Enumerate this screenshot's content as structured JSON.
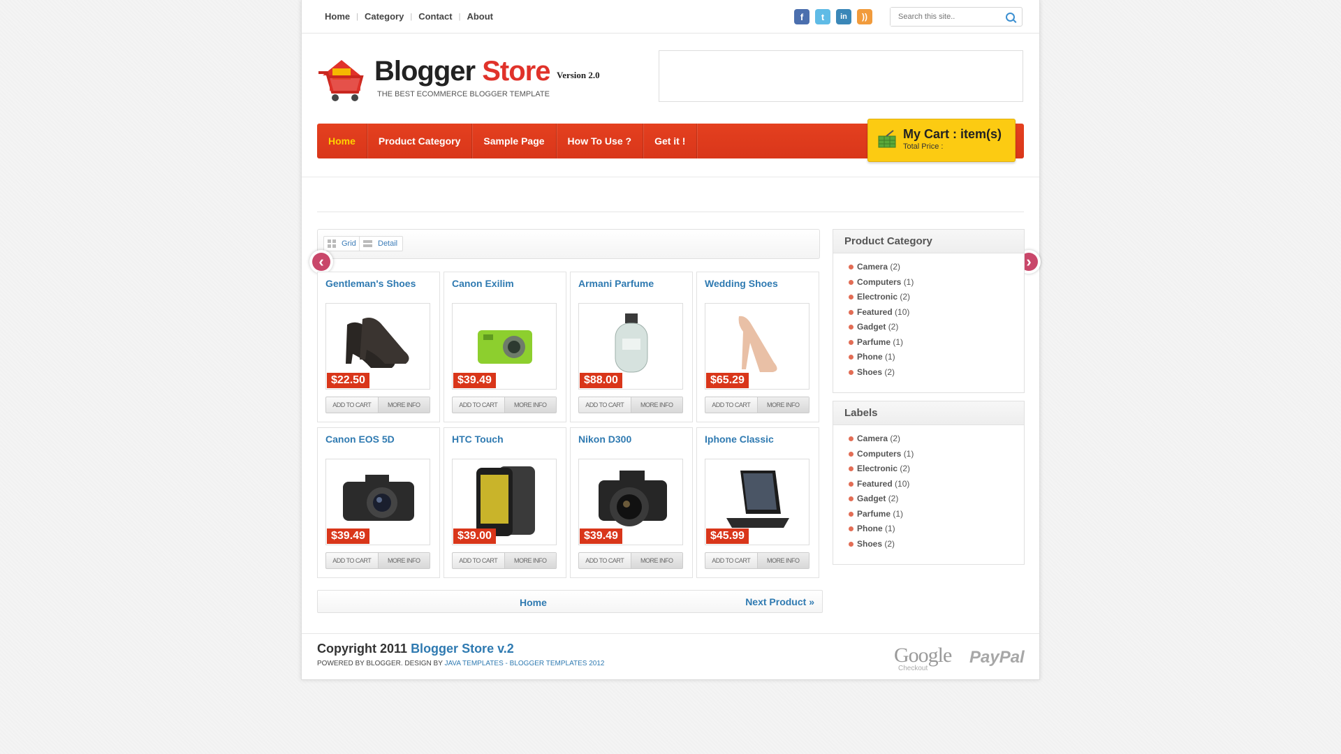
{
  "topnav": {
    "items": [
      "Home",
      "Category",
      "Contact",
      "About"
    ]
  },
  "social": {
    "icons": [
      "facebook-icon",
      "twitter-icon",
      "linkedin-icon",
      "rss-icon"
    ],
    "fb": "f",
    "tw": "t",
    "li": "in",
    "rss": "))"
  },
  "search": {
    "placeholder": "Search this site.."
  },
  "logo": {
    "title_a": "Blogger",
    "title_b": "Store",
    "version": "Version 2.0",
    "tagline": "THE BEST ECOMMERCE BLOGGER TEMPLATE"
  },
  "mainnav": {
    "items": [
      "Home",
      "Product Category",
      "Sample Page",
      "How To Use ?",
      "Get it !"
    ],
    "active": "Home"
  },
  "cart": {
    "title": "My Cart : item(s)",
    "subtitle": "Total Price :"
  },
  "viewtoggle": {
    "grid": "Grid",
    "detail": "Detail"
  },
  "products": [
    {
      "title": "Gentleman's Shoes",
      "price": "$22.50",
      "icon": "shoes-icon"
    },
    {
      "title": "Canon Exilim",
      "price": "$39.49",
      "icon": "compact-camera-icon"
    },
    {
      "title": "Armani Parfume",
      "price": "$88.00",
      "icon": "perfume-icon"
    },
    {
      "title": "Wedding Shoes",
      "price": "$65.29",
      "icon": "heels-icon"
    },
    {
      "title": "Canon EOS 5D",
      "price": "$39.49",
      "icon": "dslr-camera-icon"
    },
    {
      "title": "HTC Touch",
      "price": "$39.00",
      "icon": "phone-icon"
    },
    {
      "title": "Nikon D300",
      "price": "$39.49",
      "icon": "dslr-camera-icon"
    },
    {
      "title": "Iphone Classic",
      "price": "$45.99",
      "icon": "tablet-icon"
    }
  ],
  "buttons": {
    "add": "ADD TO CART",
    "more": "MORE INFO"
  },
  "pager": {
    "home": "Home",
    "next": "Next Product »"
  },
  "sidebar": {
    "category_title": "Product Category",
    "labels_title": "Labels",
    "items": [
      {
        "name": "Camera",
        "count": "(2)"
      },
      {
        "name": "Computers",
        "count": "(1)"
      },
      {
        "name": "Electronic",
        "count": "(2)"
      },
      {
        "name": "Featured",
        "count": "(10)"
      },
      {
        "name": "Gadget",
        "count": "(2)"
      },
      {
        "name": "Parfume",
        "count": "(1)"
      },
      {
        "name": "Phone",
        "count": "(1)"
      },
      {
        "name": "Shoes",
        "count": "(2)"
      }
    ]
  },
  "footer": {
    "copyright": "Copyright 2011",
    "site": "Blogger Store v.2",
    "powered": "POWERED BY BLOGGER. DESIGN BY",
    "java": "JAVA TEMPLATES",
    "dash": "-",
    "bt": "BLOGGER TEMPLATES 2012",
    "google": "Google",
    "checkout": "Checkout",
    "paypal": "PayPal"
  },
  "colors": {
    "accent": "#e0322a",
    "nav": "#d9361a",
    "cart": "#fccb12",
    "link": "#2f7ab1"
  }
}
